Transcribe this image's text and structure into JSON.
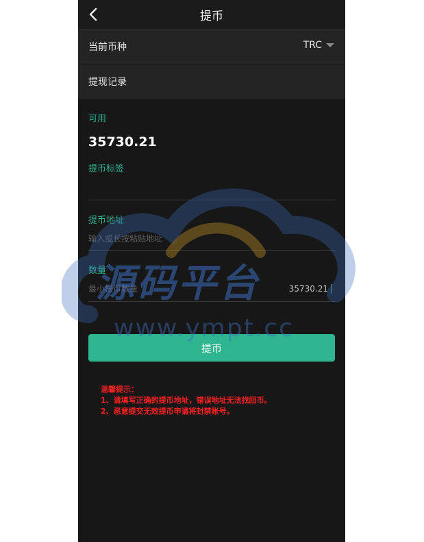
{
  "header": {
    "title": "提币"
  },
  "currency_row": {
    "label": "当前币种",
    "value": "TRC"
  },
  "history_row": {
    "label": "提现记录"
  },
  "available": {
    "label": "可用",
    "amount": "35730.21"
  },
  "tag_field": {
    "label": "提币标签",
    "value": ""
  },
  "address_field": {
    "label": "提币地址",
    "placeholder": "输入或长按粘贴地址"
  },
  "quantity_field": {
    "label": "数量",
    "placeholder": "最小提币数量",
    "max_amount": "35730.21"
  },
  "submit": {
    "label": "提币"
  },
  "tips": {
    "title": "温馨提示：",
    "line1": "1、请填写正确的提币地址，错误地址无法找回币。",
    "line2": "2、恶意提交无效提币申请将封禁账号。"
  },
  "watermark": {
    "text": "源码平台",
    "url": "www.ympt.cc"
  },
  "colors": {
    "accent": "#2fb58f",
    "background": "#171717",
    "warning": "#ff2020"
  }
}
